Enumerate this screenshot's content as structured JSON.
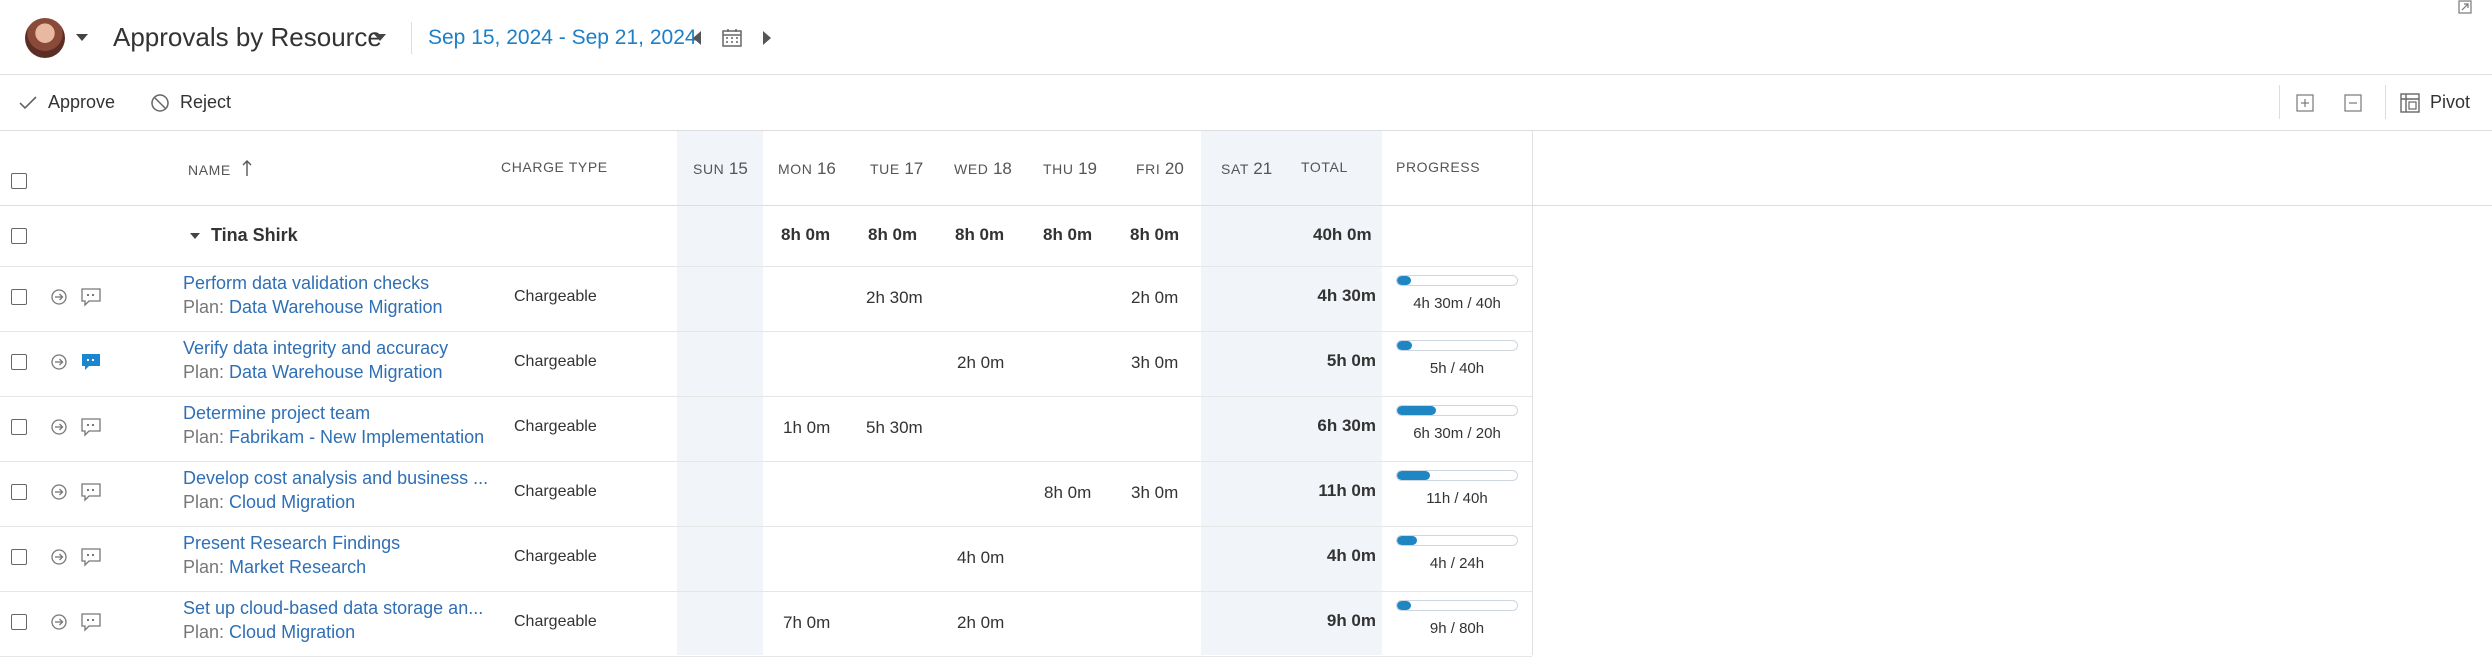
{
  "header": {
    "title": "Approvals by Resource",
    "date_range": "Sep 15, 2024 - Sep 21, 2024"
  },
  "toolbar": {
    "approve_label": "Approve",
    "reject_label": "Reject",
    "pivot_label": "Pivot"
  },
  "columns": {
    "name": "NAME",
    "charge_type": "CHARGE TYPE",
    "days": [
      {
        "dow": "SUN",
        "day": "15"
      },
      {
        "dow": "MON",
        "day": "16"
      },
      {
        "dow": "TUE",
        "day": "17"
      },
      {
        "dow": "WED",
        "day": "18"
      },
      {
        "dow": "THU",
        "day": "19"
      },
      {
        "dow": "FRI",
        "day": "20"
      },
      {
        "dow": "SAT",
        "day": "21"
      }
    ],
    "total": "TOTAL",
    "progress": "PROGRESS"
  },
  "group": {
    "name": "Tina Shirk",
    "days": [
      "",
      "8h 0m",
      "8h 0m",
      "8h 0m",
      "8h 0m",
      "8h 0m",
      ""
    ],
    "total": "40h 0m"
  },
  "rows": [
    {
      "task": "Perform data validation checks",
      "plan_prefix": "Plan:",
      "plan": "Data Warehouse Migration",
      "charge": "Chargeable",
      "days": [
        "",
        "",
        "2h 30m",
        "",
        "",
        "2h 0m",
        ""
      ],
      "total": "4h 30m",
      "progress_label": "4h 30m / 40h",
      "progress": 0.11,
      "has_comment": false
    },
    {
      "task": "Verify data integrity and accuracy",
      "plan_prefix": "Plan:",
      "plan": "Data Warehouse Migration",
      "charge": "Chargeable",
      "days": [
        "",
        "",
        "",
        "2h 0m",
        "",
        "3h 0m",
        ""
      ],
      "total": "5h 0m",
      "progress_label": "5h / 40h",
      "progress": 0.125,
      "has_comment": true
    },
    {
      "task": "Determine project team",
      "plan_prefix": "Plan:",
      "plan": "Fabrikam - New Implementation",
      "charge": "Chargeable",
      "days": [
        "",
        "1h 0m",
        "5h 30m",
        "",
        "",
        "",
        ""
      ],
      "total": "6h 30m",
      "progress_label": "6h 30m / 20h",
      "progress": 0.325,
      "has_comment": false
    },
    {
      "task": "Develop cost analysis and business ...",
      "plan_prefix": "Plan:",
      "plan": "Cloud Migration",
      "charge": "Chargeable",
      "days": [
        "",
        "",
        "",
        "",
        "8h 0m",
        "3h 0m",
        ""
      ],
      "total": "11h 0m",
      "progress_label": "11h / 40h",
      "progress": 0.275,
      "has_comment": false
    },
    {
      "task": "Present Research Findings",
      "plan_prefix": "Plan:",
      "plan": "Market Research",
      "charge": "Chargeable",
      "days": [
        "",
        "",
        "",
        "4h 0m",
        "",
        "",
        ""
      ],
      "total": "4h 0m",
      "progress_label": "4h / 24h",
      "progress": 0.167,
      "has_comment": false
    },
    {
      "task": "Set up cloud-based data storage an...",
      "plan_prefix": "Plan:",
      "plan": "Cloud Migration",
      "charge": "Chargeable",
      "days": [
        "",
        "7h 0m",
        "",
        "2h 0m",
        "",
        "",
        ""
      ],
      "total": "9h 0m",
      "progress_label": "9h / 80h",
      "progress": 0.1125,
      "has_comment": false
    }
  ]
}
